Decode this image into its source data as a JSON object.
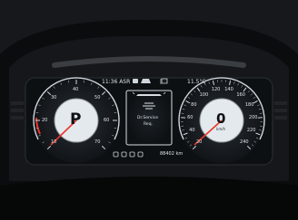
{
  "status_bar": {
    "time": "11:36 ASR",
    "outside_temp": "11.5°C",
    "left_indicators": [
      "seatbelt-warning-icon",
      "car-status-icon"
    ],
    "right_indicators": [
      "headlight-icon"
    ]
  },
  "left_gauge": {
    "type": "rpm",
    "ticks": [
      "10",
      "20",
      "30",
      "40",
      "50",
      "60",
      "70"
    ],
    "gear": "P",
    "needle_value": 0
  },
  "right_gauge": {
    "type": "speedometer",
    "ticks": [
      "20",
      "40",
      "60",
      "80",
      "100",
      "120",
      "140",
      "160",
      "180",
      "200",
      "220",
      "240"
    ],
    "speed": "0",
    "unit": "km/h",
    "needle_value": 0
  },
  "center_panel": {
    "line1": "Dr.Service",
    "line2": "Req."
  },
  "bottom_bar": {
    "odometer": "88402 km"
  },
  "colors": {
    "background": "#0b0c0e",
    "display": "#eef1f4",
    "gauge_face": "#101418",
    "accent_red": "#e8372c",
    "display_ring": "#cfd6dc"
  }
}
